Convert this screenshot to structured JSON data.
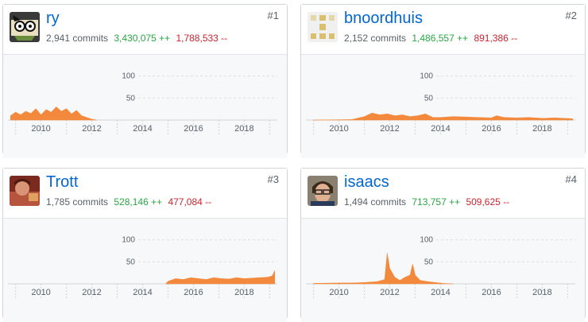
{
  "contributors": [
    {
      "rank": "#1",
      "login": "ry",
      "commits": "2,941 commits",
      "additions": "3,430,075 ++",
      "deletions": "1,788,533 --",
      "avatar_icon": "cartoon-avatar-icon"
    },
    {
      "rank": "#2",
      "login": "bnoordhuis",
      "commits": "2,152 commits",
      "additions": "1,486,557 ++",
      "deletions": "891,386 --",
      "avatar_icon": "identicon-avatar-icon"
    },
    {
      "rank": "#3",
      "login": "Trott",
      "commits": "1,785 commits",
      "additions": "528,146 ++",
      "deletions": "477,084 --",
      "avatar_icon": "photo-avatar-icon"
    },
    {
      "rank": "#4",
      "login": "isaacs",
      "commits": "1,494 commits",
      "additions": "713,757 ++",
      "deletions": "509,625 --",
      "avatar_icon": "photo-avatar-icon"
    }
  ],
  "colors": {
    "area": "#f3893c",
    "link": "#0366d6",
    "additions": "#28a745",
    "deletions": "#cb2431"
  },
  "chart_data": [
    {
      "type": "area",
      "x_ticks": [
        "2010",
        "2012",
        "2014",
        "2016",
        "2018"
      ],
      "y_ticks": [
        50,
        100
      ],
      "ylim": [
        0,
        130
      ],
      "xlim": [
        2008.7,
        2019.3
      ],
      "series": [
        {
          "points": [
            [
              2008.8,
              10
            ],
            [
              2009.0,
              18
            ],
            [
              2009.2,
              12
            ],
            [
              2009.4,
              20
            ],
            [
              2009.6,
              15
            ],
            [
              2009.8,
              26
            ],
            [
              2010.0,
              12
            ],
            [
              2010.2,
              24
            ],
            [
              2010.4,
              18
            ],
            [
              2010.6,
              30
            ],
            [
              2010.8,
              20
            ],
            [
              2011.0,
              26
            ],
            [
              2011.2,
              14
            ],
            [
              2011.4,
              22
            ],
            [
              2011.6,
              10
            ],
            [
              2011.8,
              6
            ],
            [
              2012.0,
              2
            ],
            [
              2012.2,
              0
            ]
          ]
        }
      ]
    },
    {
      "type": "area",
      "x_ticks": [
        "2010",
        "2012",
        "2014",
        "2016",
        "2018"
      ],
      "y_ticks": [
        50,
        100
      ],
      "ylim": [
        0,
        130
      ],
      "xlim": [
        2008.7,
        2019.3
      ],
      "series": [
        {
          "points": [
            [
              2009.0,
              0
            ],
            [
              2010.5,
              1
            ],
            [
              2011.0,
              8
            ],
            [
              2011.3,
              16
            ],
            [
              2011.6,
              12
            ],
            [
              2011.9,
              14
            ],
            [
              2012.2,
              10
            ],
            [
              2012.5,
              12
            ],
            [
              2012.8,
              8
            ],
            [
              2013.1,
              10
            ],
            [
              2013.4,
              14
            ],
            [
              2013.7,
              6
            ],
            [
              2014.0,
              6
            ],
            [
              2014.5,
              8
            ],
            [
              2015.0,
              7
            ],
            [
              2015.5,
              6
            ],
            [
              2016.0,
              5
            ],
            [
              2016.2,
              10
            ],
            [
              2016.5,
              6
            ],
            [
              2017.0,
              5
            ],
            [
              2017.5,
              6
            ],
            [
              2018.0,
              4
            ],
            [
              2018.5,
              5
            ],
            [
              2019.2,
              3
            ]
          ]
        }
      ]
    },
    {
      "type": "area",
      "x_ticks": [
        "2010",
        "2012",
        "2014",
        "2016",
        "2018"
      ],
      "y_ticks": [
        50,
        100
      ],
      "ylim": [
        0,
        130
      ],
      "xlim": [
        2008.7,
        2019.3
      ],
      "series": [
        {
          "points": [
            [
              2014.9,
              0
            ],
            [
              2015.0,
              6
            ],
            [
              2015.3,
              12
            ],
            [
              2015.6,
              10
            ],
            [
              2015.9,
              14
            ],
            [
              2016.2,
              12
            ],
            [
              2016.5,
              10
            ],
            [
              2016.8,
              14
            ],
            [
              2017.1,
              12
            ],
            [
              2017.4,
              11
            ],
            [
              2017.7,
              14
            ],
            [
              2018.0,
              12
            ],
            [
              2018.3,
              13
            ],
            [
              2018.6,
              14
            ],
            [
              2018.9,
              15
            ],
            [
              2019.1,
              18
            ],
            [
              2019.2,
              30
            ]
          ]
        }
      ]
    },
    {
      "type": "area",
      "x_ticks": [
        "2010",
        "2012",
        "2014",
        "2016",
        "2018"
      ],
      "y_ticks": [
        50,
        100
      ],
      "ylim": [
        0,
        130
      ],
      "xlim": [
        2008.7,
        2019.3
      ],
      "series": [
        {
          "points": [
            [
              2009.0,
              1
            ],
            [
              2010.0,
              2
            ],
            [
              2010.5,
              2
            ],
            [
              2011.0,
              3
            ],
            [
              2011.5,
              5
            ],
            [
              2011.8,
              10
            ],
            [
              2011.9,
              70
            ],
            [
              2012.0,
              35
            ],
            [
              2012.2,
              15
            ],
            [
              2012.4,
              8
            ],
            [
              2012.6,
              15
            ],
            [
              2012.8,
              20
            ],
            [
              2012.9,
              45
            ],
            [
              2013.0,
              20
            ],
            [
              2013.2,
              8
            ],
            [
              2013.5,
              5
            ],
            [
              2013.8,
              3
            ],
            [
              2014.1,
              1
            ],
            [
              2014.5,
              0
            ]
          ]
        }
      ]
    }
  ]
}
